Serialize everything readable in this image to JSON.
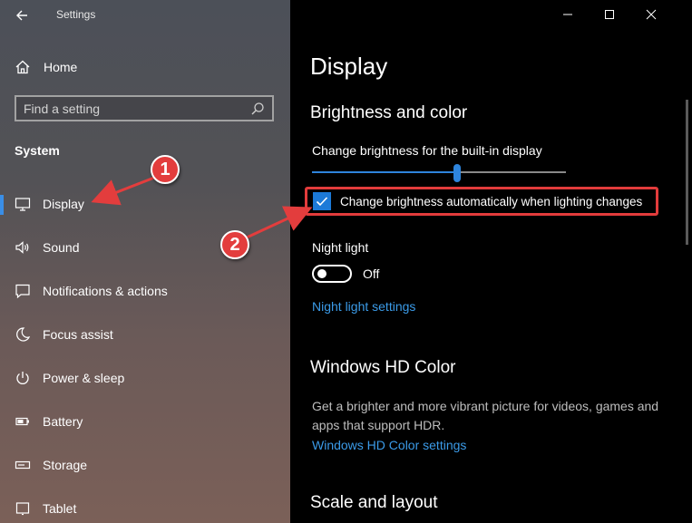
{
  "sidebar": {
    "app_title": "Settings",
    "home_label": "Home",
    "search_placeholder": "Find a setting",
    "section_title": "System",
    "items": [
      {
        "label": "Display",
        "icon": "monitor-icon"
      },
      {
        "label": "Sound",
        "icon": "speaker-icon"
      },
      {
        "label": "Notifications & actions",
        "icon": "notification-icon"
      },
      {
        "label": "Focus assist",
        "icon": "moon-icon"
      },
      {
        "label": "Power & sleep",
        "icon": "power-icon"
      },
      {
        "label": "Battery",
        "icon": "battery-icon"
      },
      {
        "label": "Storage",
        "icon": "storage-icon"
      },
      {
        "label": "Tablet",
        "icon": "tablet-icon"
      }
    ],
    "selected_index": 0
  },
  "main": {
    "page_title": "Display",
    "brightness_heading": "Brightness and color",
    "brightness_label": "Change brightness for the built-in display",
    "brightness_level": 0.57,
    "auto_brightness_label": "Change brightness automatically when lighting changes",
    "auto_brightness_checked": true,
    "night_light_label": "Night light",
    "night_light_state": "Off",
    "night_light_on": false,
    "night_light_link": "Night light settings",
    "hd_heading": "Windows HD Color",
    "hd_description": "Get a brighter and more vibrant picture for videos, games and apps that support HDR.",
    "hd_link": "Windows HD Color settings",
    "scale_heading": "Scale and layout"
  },
  "annotations": {
    "badge1": "1",
    "badge2": "2",
    "color": "#e33d3d"
  },
  "colors": {
    "accent": "#2e84dc",
    "link": "#3b9be8",
    "highlight_border": "#e23b3b"
  }
}
